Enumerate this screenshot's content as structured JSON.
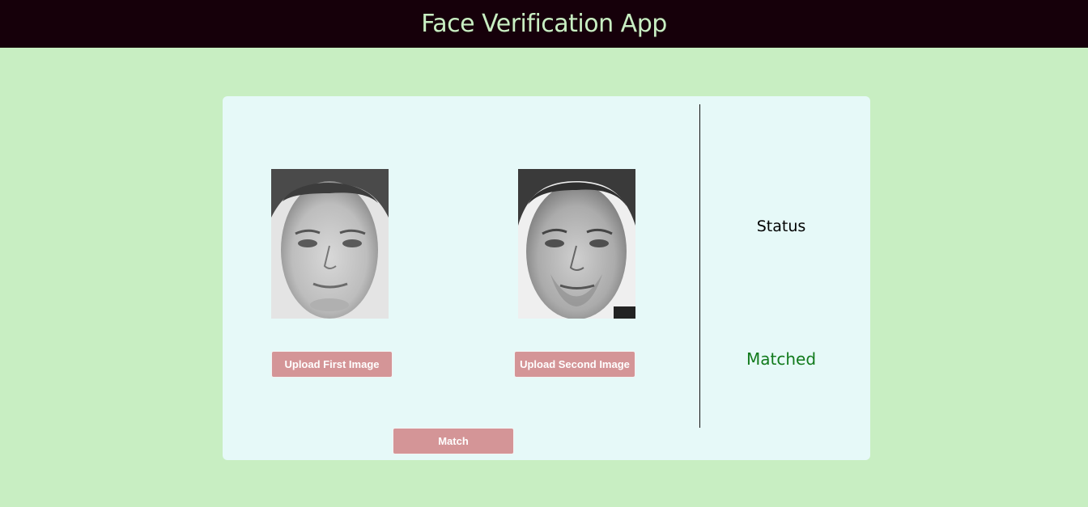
{
  "header": {
    "title": "Face Verification App"
  },
  "images": {
    "first_alt": "face-photo-1",
    "second_alt": "face-photo-2"
  },
  "buttons": {
    "upload_first": "Upload First Image",
    "upload_second": "Upload Second Image",
    "match": "Match"
  },
  "status": {
    "label": "Status",
    "value": "Matched"
  },
  "colors": {
    "header_bg": "#16000a",
    "page_bg": "#c8eec2",
    "card_bg": "#e6f9f8",
    "button_bg": "#d49597",
    "match_text": "#117a1c"
  }
}
